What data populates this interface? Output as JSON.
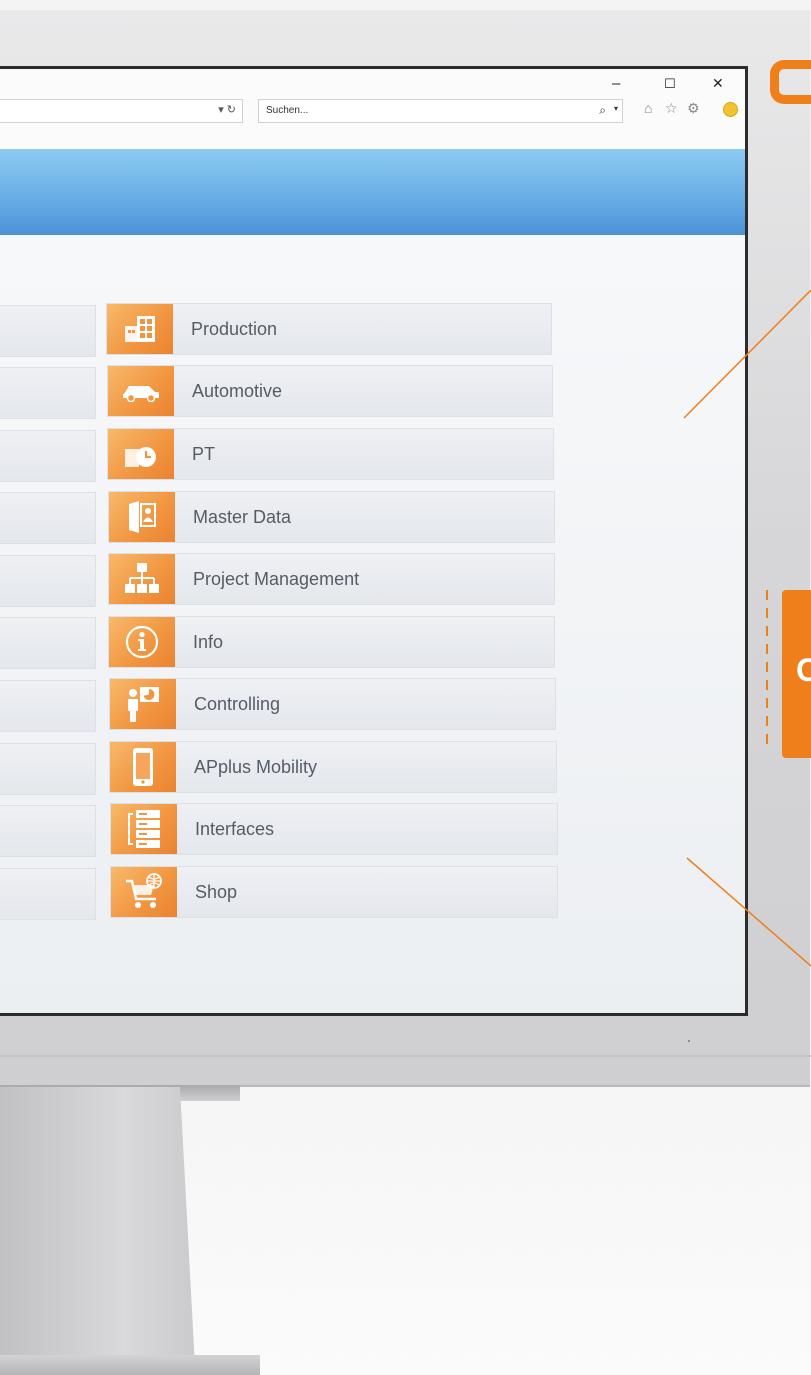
{
  "browser": {
    "search_placeholder": "Suchen...",
    "minimize_glyph": "–",
    "maximize_glyph": "☐",
    "close_glyph": "✕",
    "refresh_glyph": "▾ ↻",
    "search_glyph": "⌕",
    "dropdown_glyph": "▾",
    "home_glyph": "⌂",
    "favorite_glyph": "☆",
    "settings_glyph": "⚙"
  },
  "menu": {
    "items": [
      {
        "label": "Production",
        "icon": "factory-icon"
      },
      {
        "label": "Automotive",
        "icon": "car-icon"
      },
      {
        "label": "PT",
        "icon": "building-clock-icon"
      },
      {
        "label": "Master Data",
        "icon": "folder-person-icon"
      },
      {
        "label": "Project Management",
        "icon": "hierarchy-icon"
      },
      {
        "label": "Info",
        "icon": "info-icon"
      },
      {
        "label": "Controlling",
        "icon": "presentation-icon"
      },
      {
        "label": "APplus Mobility",
        "icon": "smartphone-icon"
      },
      {
        "label": "Interfaces",
        "icon": "server-icon"
      },
      {
        "label": "Shop",
        "icon": "shopping-cart-icon"
      }
    ]
  },
  "side_tab": {
    "text": "C"
  },
  "colors": {
    "accent": "#ee7f1b",
    "banner": "#5fa6e2",
    "tile_text": "#565c66"
  }
}
